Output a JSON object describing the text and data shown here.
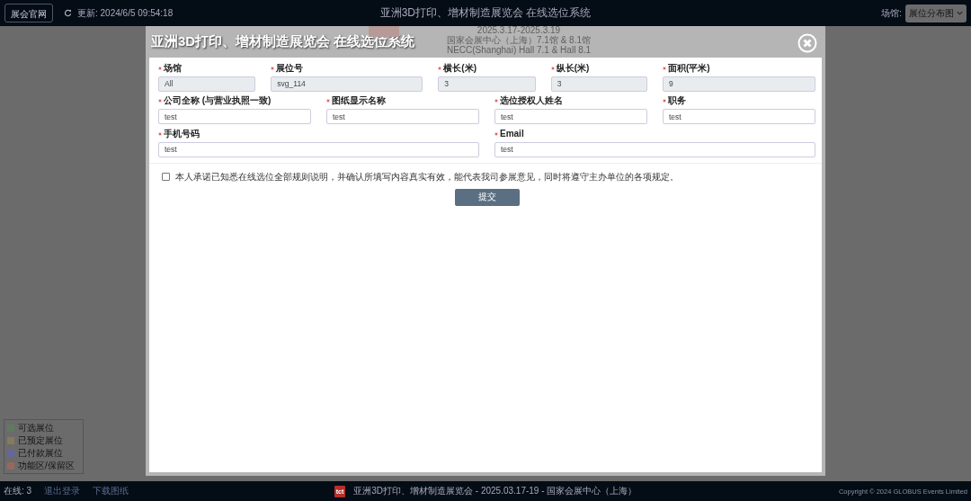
{
  "top_bar": {
    "site_button": "展会官网",
    "updated": "更新: 2024/6/5 09:54:18",
    "title": "亚洲3D打印、增材制造展览会 在线选位系统",
    "venue_label": "场馆:",
    "venue_select": "展位分布图"
  },
  "modal": {
    "title": "亚洲3D打印、增材制造展览会 在线选位系统",
    "header_lines": [
      "2025.3.17-2025.3.19",
      "国家会展中心（上海）7.1馆 & 8.1馆",
      "NECC(Shanghai) Hall 7.1 & Hall 8.1"
    ],
    "rows": [
      {
        "fields": [
          {
            "label": "场馆",
            "required": true,
            "value": "All",
            "readonly": true
          },
          {
            "label": "展位号",
            "required": true,
            "value": "svg_114",
            "readonly": true
          },
          {
            "label": "横长(米)",
            "required": true,
            "value": "3",
            "readonly": true
          },
          {
            "label": "纵长(米)",
            "required": true,
            "value": "3",
            "readonly": true
          },
          {
            "label": "面积(平米)",
            "required": true,
            "value": "9",
            "readonly": true
          }
        ]
      },
      {
        "fields": [
          {
            "label": "公司全称 (与营业执照一致)",
            "required": true,
            "value": "test",
            "readonly": false
          },
          {
            "label": "图纸显示名称",
            "required": true,
            "value": "test",
            "readonly": false
          },
          {
            "label": "选位授权人姓名",
            "required": true,
            "value": "test",
            "readonly": false
          },
          {
            "label": "职务",
            "required": true,
            "value": "test",
            "readonly": false
          }
        ]
      },
      {
        "fields": [
          {
            "label": "手机号码",
            "required": true,
            "value": "test",
            "readonly": false
          },
          {
            "label": "Email",
            "required": true,
            "value": "test",
            "readonly": false
          }
        ]
      }
    ],
    "agreement": {
      "text": "本人承诺已知悉在线选位全部规则说明，并确认所填写内容真实有效，能代表我司参展意见，同时将遵守主办单位的各项规定。",
      "checked": false
    },
    "submit": "提交"
  },
  "legend": [
    {
      "label": "可选展位",
      "color": "#5e7b5e"
    },
    {
      "label": "已预定展位",
      "color": "#857a5c"
    },
    {
      "label": "已付款展位",
      "color": "#64679a"
    },
    {
      "label": "功能区/保留区",
      "color": "#96675e"
    }
  ],
  "footer": {
    "online": "在线: 3",
    "logout": "退出登录",
    "download": "下载图纸",
    "logo": "tct",
    "info": "亚洲3D打印、增材制造展览会 - 2025.03.17-19 - 国家会展中心（上海）",
    "copyright": "Copyright © 2024 GLOBUS Events Limited"
  }
}
